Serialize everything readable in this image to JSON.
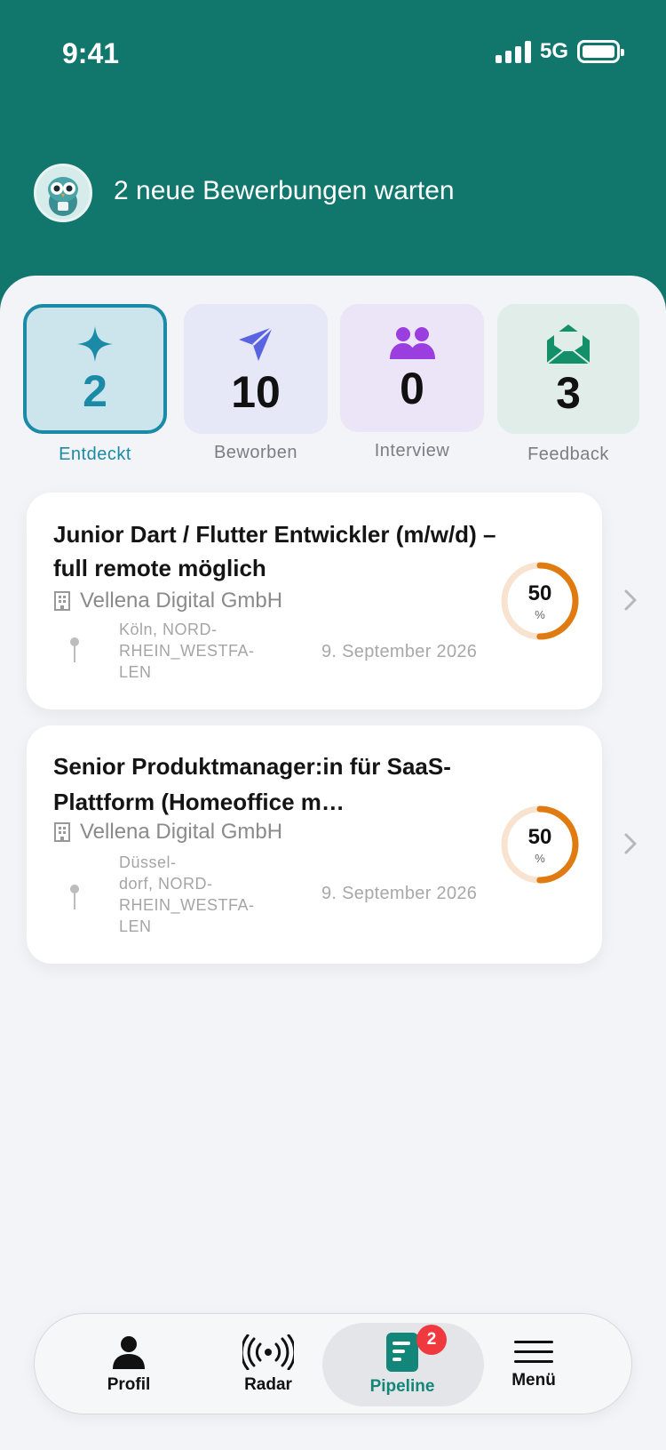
{
  "status_bar": {
    "time": "9:41",
    "network": "5G"
  },
  "header": {
    "message": "2 neue Bewerbungen warten"
  },
  "stats": [
    {
      "label": "Entdeckt",
      "count": "2",
      "icon": "sparkle-icon",
      "active": true
    },
    {
      "label": "Beworben",
      "count": "10",
      "icon": "paper-plane-icon",
      "active": false
    },
    {
      "label": "Interview",
      "count": "0",
      "icon": "people-icon",
      "active": false
    },
    {
      "label": "Feedback",
      "count": "3",
      "icon": "open-envelope-icon",
      "active": false
    }
  ],
  "jobs": [
    {
      "title": "Junior Dart / Flutter Entwickler (m/w/d) – full remote möglich",
      "company": "Vellena Digital GmbH",
      "location": "Köln, NORD-\nRHEIN_WESTFA-\nLEN",
      "date": "9. September 2026",
      "score": "50",
      "score_unit": "%",
      "score_fraction": 0.5
    },
    {
      "title": "Senior Produktmanager:in für SaaS-Plattform (Homeoffice m…",
      "company": "Vellena Digital GmbH",
      "location": "Düssel-\ndorf, NORD-\nRHEIN_WESTFA-\nLEN",
      "date": "9. September 2026",
      "score": "50",
      "score_unit": "%",
      "score_fraction": 0.5
    }
  ],
  "nav": {
    "items": [
      {
        "label": "Profil",
        "icon": "person-icon"
      },
      {
        "label": "Radar",
        "icon": "radar-icon"
      },
      {
        "label": "Pipeline",
        "icon": "pipeline-icon",
        "badge": "2",
        "active": true
      },
      {
        "label": "Menü",
        "icon": "hamburger-menu-icon"
      }
    ]
  },
  "colors": {
    "header": "#11766c",
    "accent": "#1a8aa6",
    "score_ring": "#e07b12",
    "score_track": "#f7e3cf",
    "badge": "#f0383f"
  }
}
